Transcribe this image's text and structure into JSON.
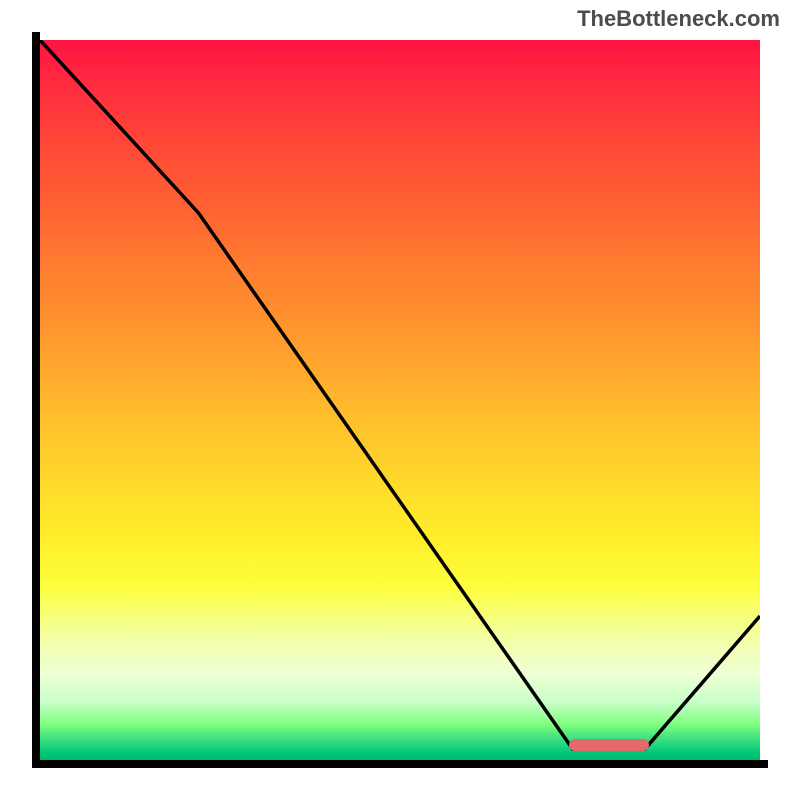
{
  "attribution": "TheBottleneck.com",
  "chart_data": {
    "type": "line",
    "title": "",
    "xlabel": "",
    "ylabel": "",
    "xlim": [
      0,
      100
    ],
    "ylim": [
      0,
      100
    ],
    "curve_points": [
      {
        "x": 0,
        "y": 100
      },
      {
        "x": 22,
        "y": 76
      },
      {
        "x": 74,
        "y": 1.5
      },
      {
        "x": 84,
        "y": 1.5
      },
      {
        "x": 100,
        "y": 20
      }
    ],
    "marker": {
      "x_start": 74,
      "x_end": 84,
      "y": 1.5
    },
    "colors": {
      "top": "#ff1342",
      "mid": "#ffdb2b",
      "bottom": "#00b86f",
      "curve": "#000000",
      "marker": "#e06a6c",
      "axis": "#000000"
    }
  }
}
